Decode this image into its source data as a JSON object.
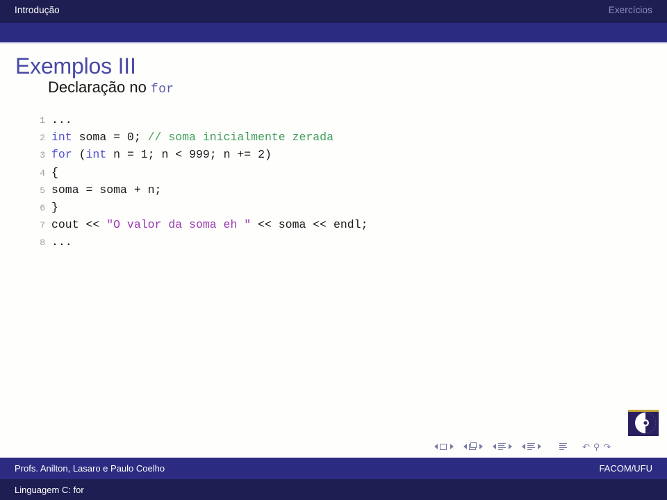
{
  "header": {
    "sections": [
      {
        "label": "Introdução",
        "state": "active"
      },
      {
        "label": "Exercícios",
        "state": "inactive"
      }
    ],
    "active_color": "#ffffff",
    "inactive_color": "#8e8ec4",
    "bar_color": "#1e1e52",
    "band_color": "#2b2b82"
  },
  "slide": {
    "title": "Exemplos III",
    "subtitle_text": "Declaração no ",
    "subtitle_mono": "for",
    "title_color": "#4949a6",
    "subtitle_color": "#151515",
    "subtitle_mono_color": "#5a5aab"
  },
  "listing": {
    "keyword_color": "#4f4fd0",
    "comment_color": "#3f9e5a",
    "string_color": "#9b39b0",
    "lineno_color": "#9d9d9d",
    "lines": [
      {
        "no": "1",
        "tokens": [
          {
            "t": "...",
            "c": "plain"
          }
        ]
      },
      {
        "no": "2",
        "tokens": [
          {
            "t": "int",
            "c": "keyword"
          },
          {
            "t": " soma = 0; ",
            "c": "plain"
          },
          {
            "t": "// soma inicialmente zerada",
            "c": "comment"
          }
        ]
      },
      {
        "no": "3",
        "tokens": [
          {
            "t": "for",
            "c": "keyword"
          },
          {
            "t": " (",
            "c": "plain"
          },
          {
            "t": "int",
            "c": "keyword"
          },
          {
            "t": " n = 1; n < 999; n += 2)",
            "c": "plain"
          }
        ]
      },
      {
        "no": "4",
        "tokens": [
          {
            "t": "{",
            "c": "plain"
          }
        ]
      },
      {
        "no": "5",
        "tokens": [
          {
            "t": "soma = soma + n;",
            "c": "plain"
          }
        ]
      },
      {
        "no": "6",
        "tokens": [
          {
            "t": "}",
            "c": "plain"
          }
        ]
      },
      {
        "no": "7",
        "tokens": [
          {
            "t": "cout << ",
            "c": "plain"
          },
          {
            "t": "\"O valor da soma eh \"",
            "c": "string"
          },
          {
            "t": " << soma << endl;",
            "c": "plain"
          }
        ]
      },
      {
        "no": "8",
        "tokens": [
          {
            "t": "...",
            "c": "plain"
          }
        ]
      }
    ]
  },
  "navigation": {
    "groups": [
      {
        "name": "slide",
        "icon": "slide-icon"
      },
      {
        "name": "frame",
        "icon": "frame-icon"
      },
      {
        "name": "subsection",
        "icon": "subsection-icon"
      },
      {
        "name": "section",
        "icon": "section-icon"
      }
    ],
    "presentation_icon": "presentation-icon",
    "back_glyph": "↶",
    "search_glyph": "⚲",
    "forward_glyph": "↷"
  },
  "footer": {
    "author": "Profs. Anilton, Lasaro e Paulo Coelho",
    "institute": "FACOM/UFU",
    "short_title": "Linguagem C: for",
    "upper_color": "#2b2b82",
    "lower_color": "#1e1e52",
    "text_color": "#ffffff"
  },
  "logo": {
    "name": "facom-ufu-logo",
    "block_color": "#2a2060",
    "accent_color": "#c6a83a"
  }
}
